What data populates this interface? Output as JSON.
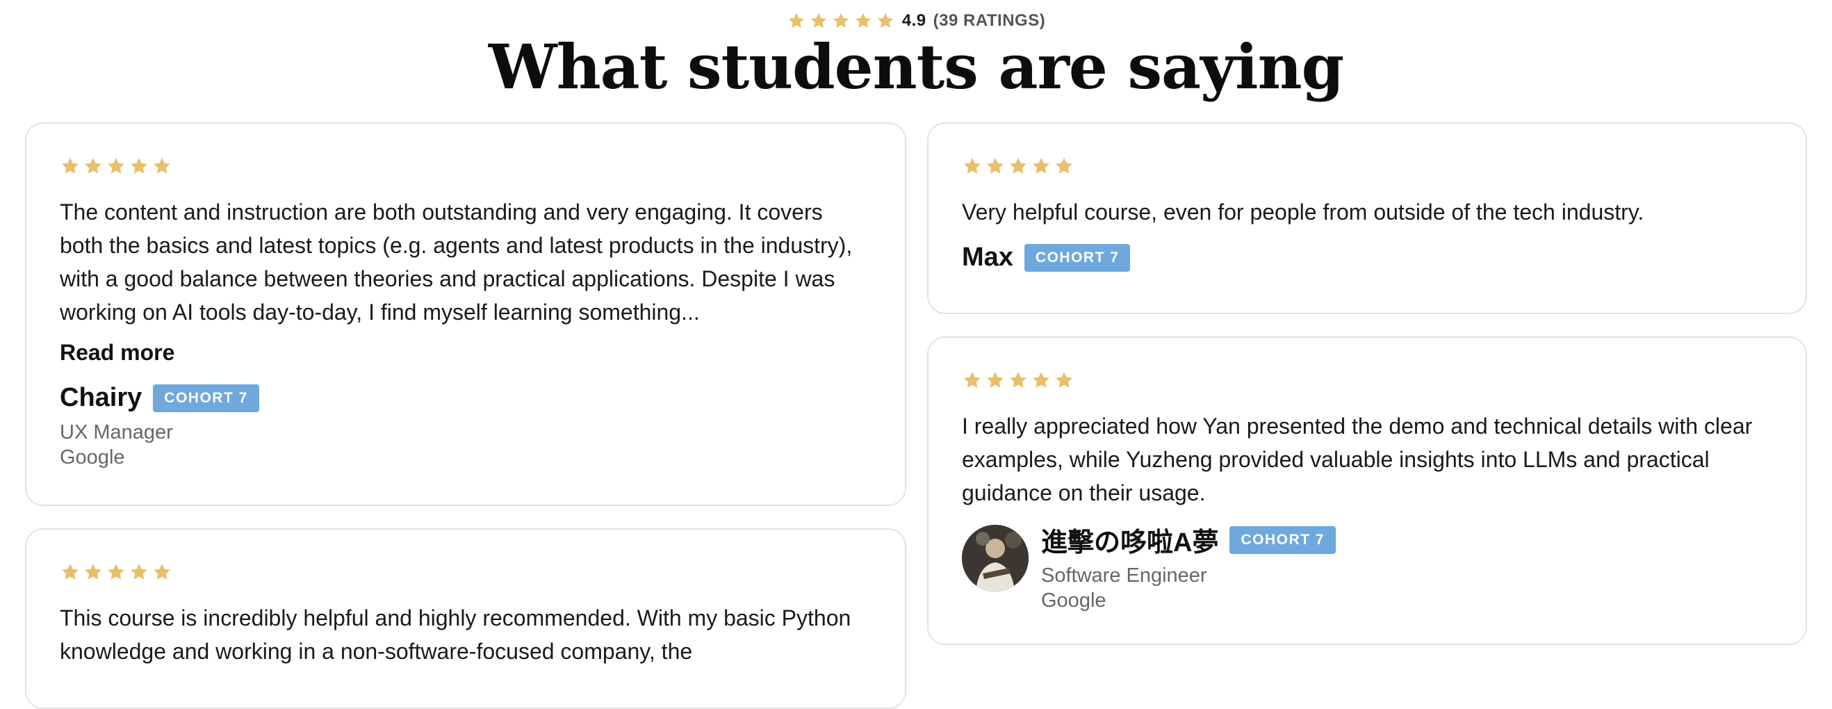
{
  "header": {
    "rating_value": "4.9",
    "rating_count": "(39 RATINGS)",
    "title": "What students are saying"
  },
  "colors": {
    "star": "#e8bf6a",
    "cohort_badge": "#6fa8dc",
    "card_border": "#e3e3e3"
  },
  "reviews": [
    {
      "stars": 5,
      "text": "The content and instruction are both outstanding and very engaging. It covers both the basics and latest topics (e.g. agents and latest products in the industry), with a good balance between theories and practical applications. Despite I was working on AI tools day-to-day, I find myself learning something...",
      "read_more": "Read more",
      "name": "Chairy",
      "cohort": "COHORT 7",
      "role": "UX Manager",
      "company": "Google"
    },
    {
      "stars": 5,
      "text": "Very helpful course, even for people from outside of the tech industry.",
      "name": "Max",
      "cohort": "COHORT 7"
    },
    {
      "stars": 5,
      "text": "I really appreciated how Yan presented the demo and technical details with clear examples, while Yuzheng provided valuable insights into LLMs and practical guidance on their usage.",
      "name": "進擊の哆啦A夢",
      "cohort": "COHORT 7",
      "role": "Software Engineer",
      "company": "Google",
      "avatar": "user-avatar-photo"
    },
    {
      "stars": 5,
      "text": "This course is incredibly helpful and highly recommended. With my basic Python knowledge and working in a non-software-focused company, the"
    }
  ]
}
